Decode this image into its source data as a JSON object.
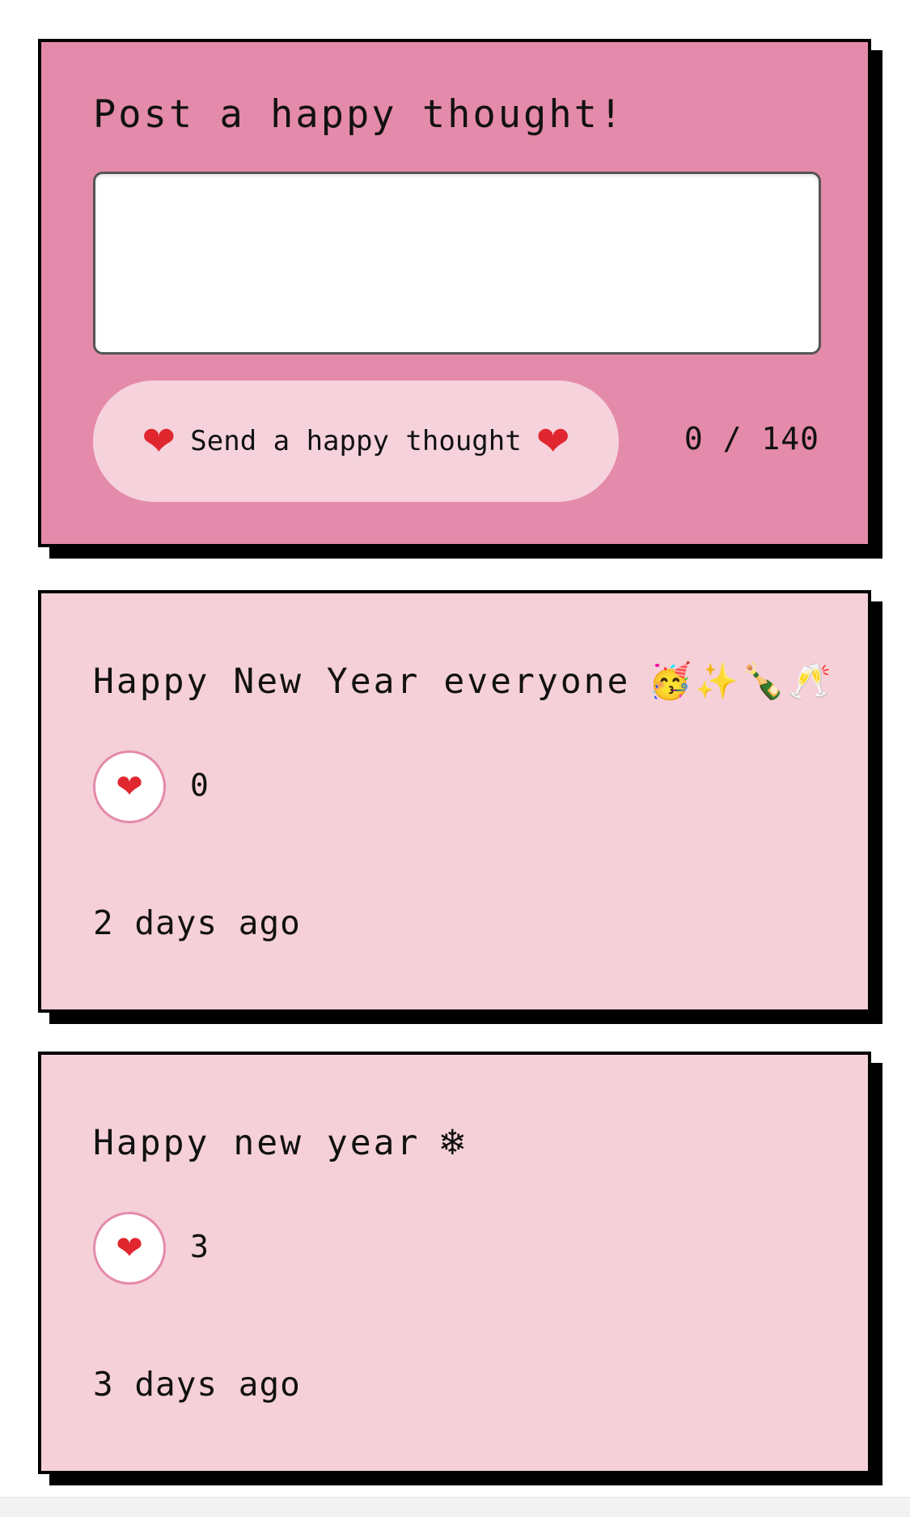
{
  "form": {
    "title": "Post a happy thought!",
    "input_value": "",
    "send_button": {
      "label": "Send a happy thought",
      "icon_left": "❤",
      "icon_right": "❤"
    },
    "char_count": "0 / 140"
  },
  "thoughts": [
    {
      "message": "Happy New Year everyone",
      "emoji": "🥳✨🍾🥂",
      "like_icon": "❤",
      "likes": "0",
      "time": "2 days ago"
    },
    {
      "message": "Happy new year",
      "emoji": "❄",
      "like_icon": "❤",
      "likes": "3",
      "time": "3 days ago"
    }
  ],
  "colors": {
    "form_background": "#e48aaa",
    "thought_background": "#f5d0d8",
    "button_background": "#f6d3dc",
    "heart": "#e0262f",
    "border": "#000000"
  }
}
